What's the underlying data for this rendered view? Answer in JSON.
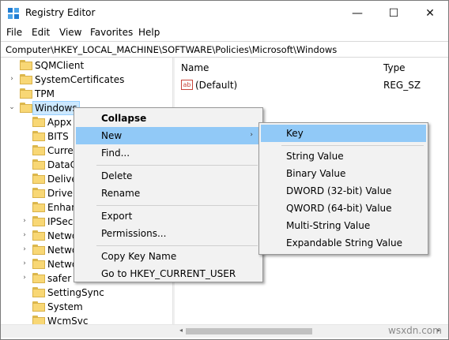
{
  "window": {
    "title": "Registry Editor"
  },
  "titlebar": {
    "minimize": "—",
    "maximize": "☐",
    "close": "✕"
  },
  "menu": [
    "File",
    "Edit",
    "View",
    "Favorites",
    "Help"
  ],
  "address": "Computer\\HKEY_LOCAL_MACHINE\\SOFTWARE\\Policies\\Microsoft\\Windows",
  "tree": [
    {
      "label": "SQMClient",
      "arrow": "",
      "level": 1
    },
    {
      "label": "SystemCertificates",
      "arrow": "›",
      "level": 1
    },
    {
      "label": "TPM",
      "arrow": "",
      "level": 1
    },
    {
      "label": "Windows",
      "arrow": "⌄",
      "level": 1,
      "selected": true
    },
    {
      "label": "Appx",
      "arrow": "",
      "level": 2
    },
    {
      "label": "BITS",
      "arrow": "",
      "level": 2
    },
    {
      "label": "Curren",
      "arrow": "",
      "level": 2
    },
    {
      "label": "DataC",
      "arrow": "",
      "level": 2
    },
    {
      "label": "Delive",
      "arrow": "",
      "level": 2
    },
    {
      "label": "Driver",
      "arrow": "",
      "level": 2
    },
    {
      "label": "Enhan",
      "arrow": "",
      "level": 2
    },
    {
      "label": "IPSec",
      "arrow": "›",
      "level": 2
    },
    {
      "label": "Netwo",
      "arrow": "›",
      "level": 2
    },
    {
      "label": "Netwo",
      "arrow": "›",
      "level": 2
    },
    {
      "label": "Netwo",
      "arrow": "›",
      "level": 2
    },
    {
      "label": "safer",
      "arrow": "›",
      "level": 2
    },
    {
      "label": "SettingSync",
      "arrow": "",
      "level": 2
    },
    {
      "label": "System",
      "arrow": "",
      "level": 2
    },
    {
      "label": "WcmSvc",
      "arrow": "",
      "level": 2
    }
  ],
  "columns": {
    "name": "Name",
    "type": "Type"
  },
  "values": [
    {
      "icon": "ab",
      "name": "(Default)",
      "type": "REG_SZ"
    }
  ],
  "context_menu": {
    "collapse": "Collapse",
    "new": "New",
    "find": "Find...",
    "delete": "Delete",
    "rename": "Rename",
    "export": "Export",
    "permissions": "Permissions...",
    "copy_key_name": "Copy Key Name",
    "goto": "Go to HKEY_CURRENT_USER",
    "submenu_arrow": "›"
  },
  "new_submenu": {
    "key": "Key",
    "string": "String Value",
    "binary": "Binary Value",
    "dword": "DWORD (32-bit) Value",
    "qword": "QWORD (64-bit) Value",
    "multistring": "Multi-String Value",
    "expandable": "Expandable String Value"
  },
  "scroll": {
    "left": "◂",
    "right": "▸"
  },
  "watermark": "wsxdn.com",
  "colors": {
    "highlight": "#91c9f7",
    "selection": "#cce8ff",
    "folder": "#f8d775"
  }
}
